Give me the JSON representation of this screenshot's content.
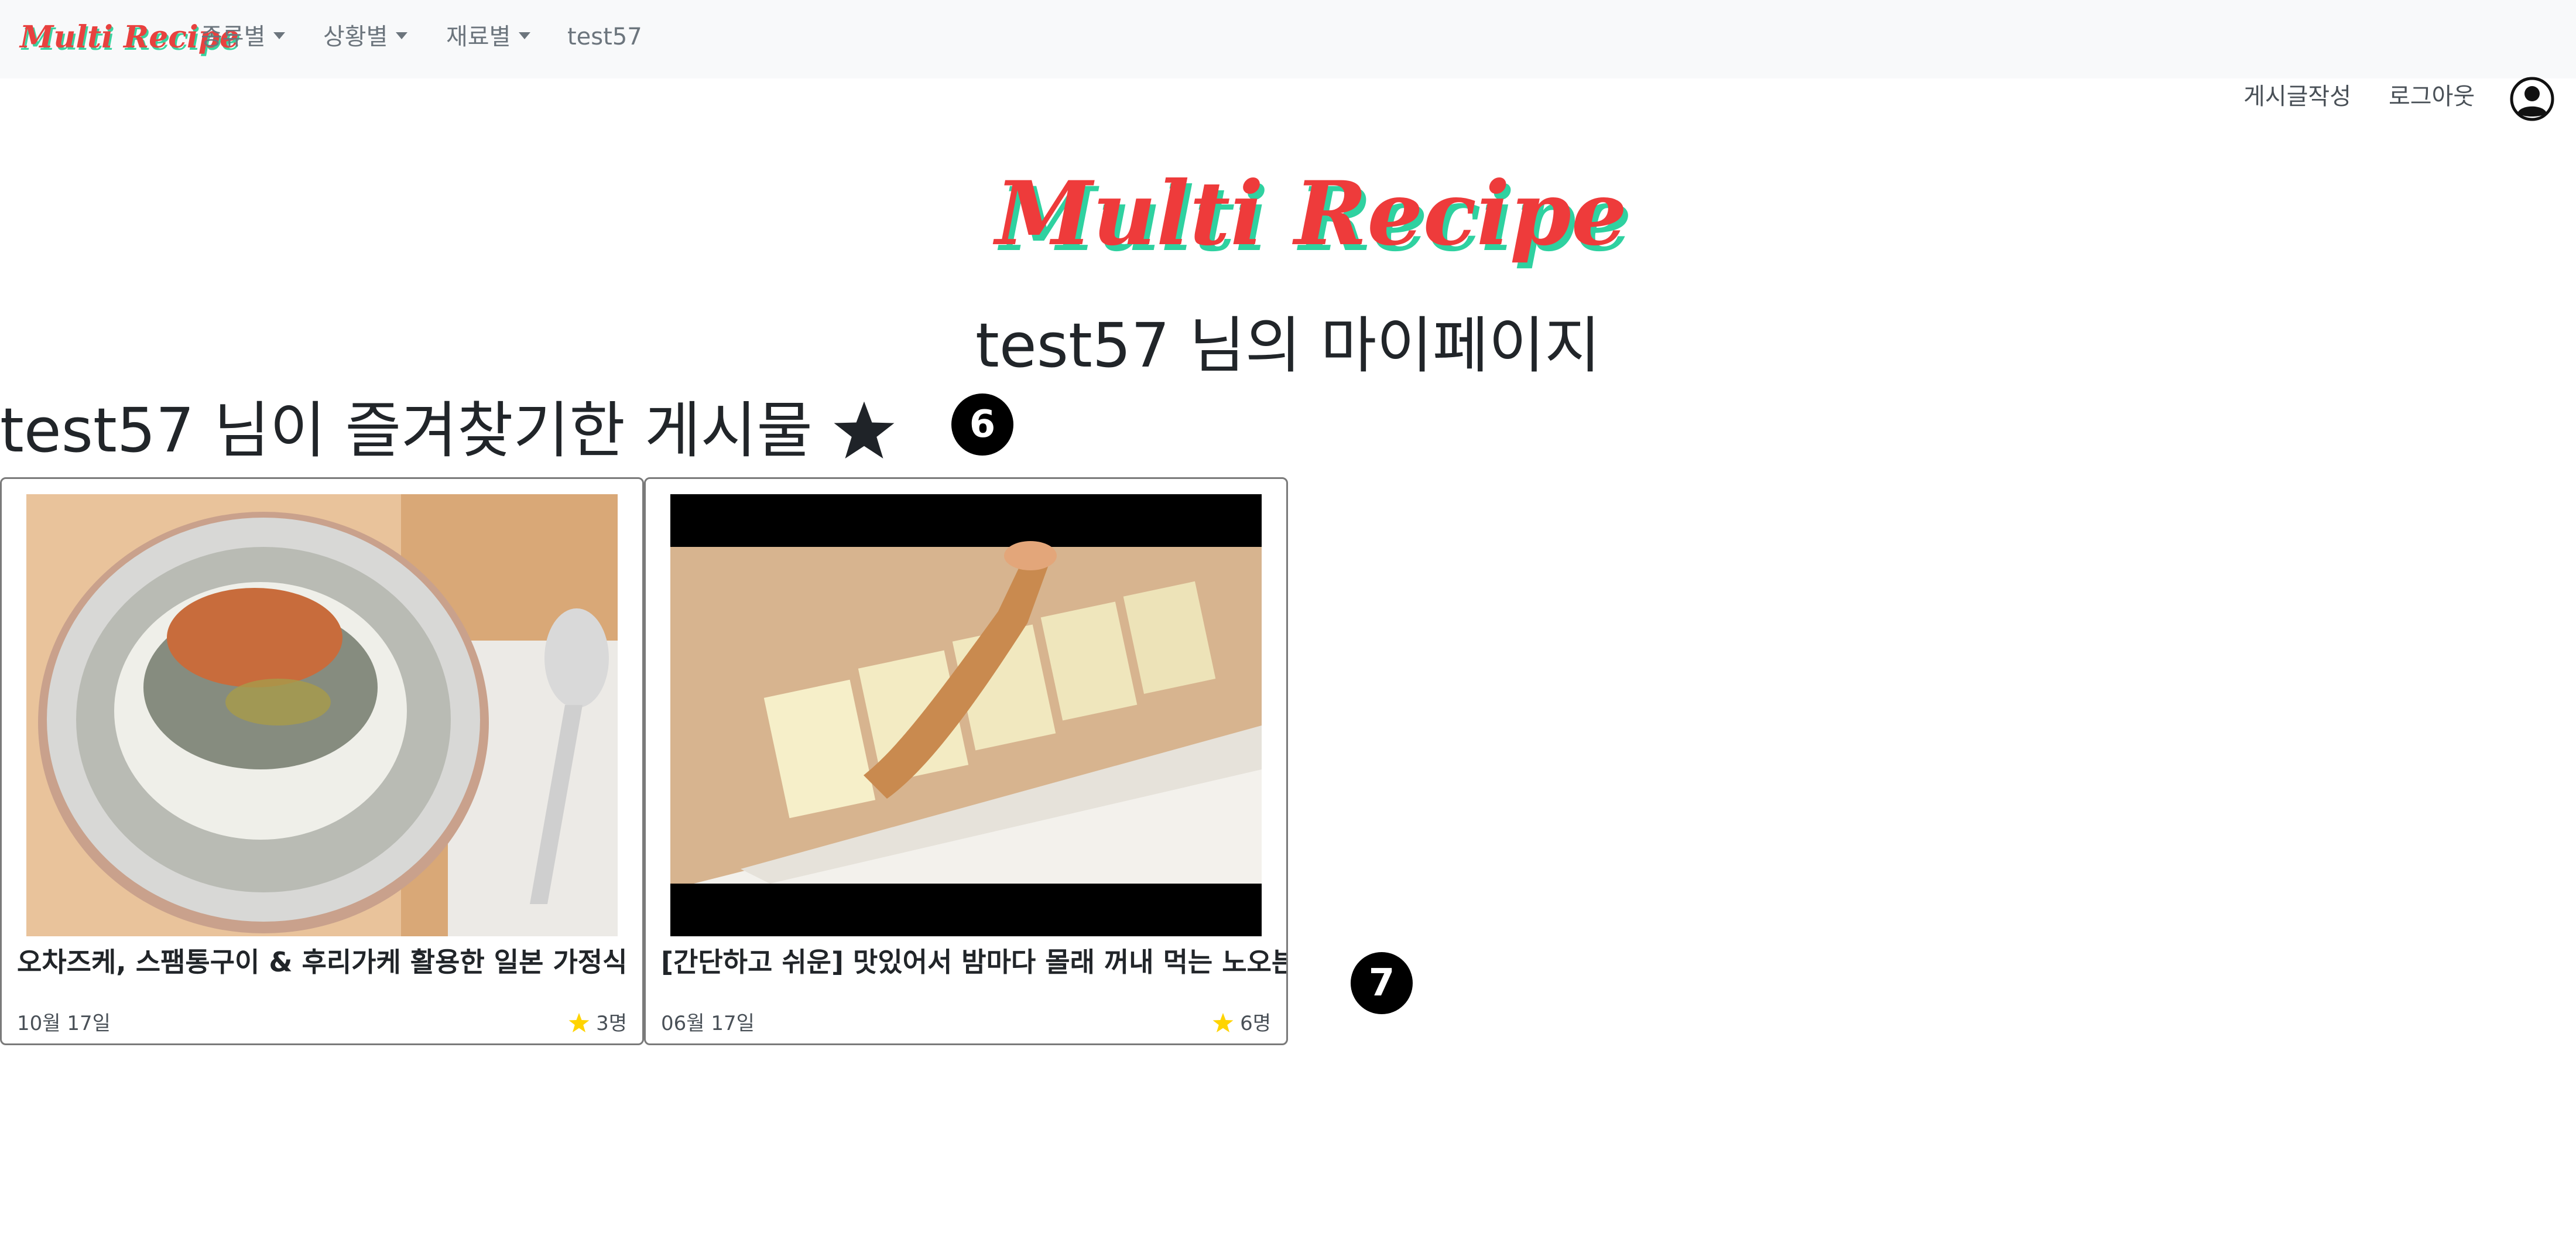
{
  "navbar": {
    "brand": "Multi Recipe",
    "menus": [
      {
        "label": "종류별"
      },
      {
        "label": "상황별"
      },
      {
        "label": "재료별"
      }
    ],
    "user_link": "test57"
  },
  "actions": {
    "write_post": "게시글작성",
    "logout": "로그아웃"
  },
  "hero": {
    "logo_text": "Multi Recipe"
  },
  "page": {
    "title": "test57 님의 마이페이지",
    "favorites_heading": "test57 님이 즐겨찾기한 게시물"
  },
  "badges": [
    "6",
    "7"
  ],
  "cards": [
    {
      "title": "오차즈케, 스팸통구이 & 후리가케 활용한 일본 가정식",
      "date": "10월 17일",
      "favorites": "3명"
    },
    {
      "title": "[간단하고 쉬운] 맛있어서 밤마다 몰래 꺼내 먹는 노오븐 치즈케이크",
      "date": "06월 17일",
      "favorites": "6명"
    }
  ],
  "colors": {
    "brand_red": "#e8413f",
    "brand_shadow": "#3ad29f",
    "navbar_bg": "#f8f9fa",
    "star_yellow": "#ffd400"
  }
}
